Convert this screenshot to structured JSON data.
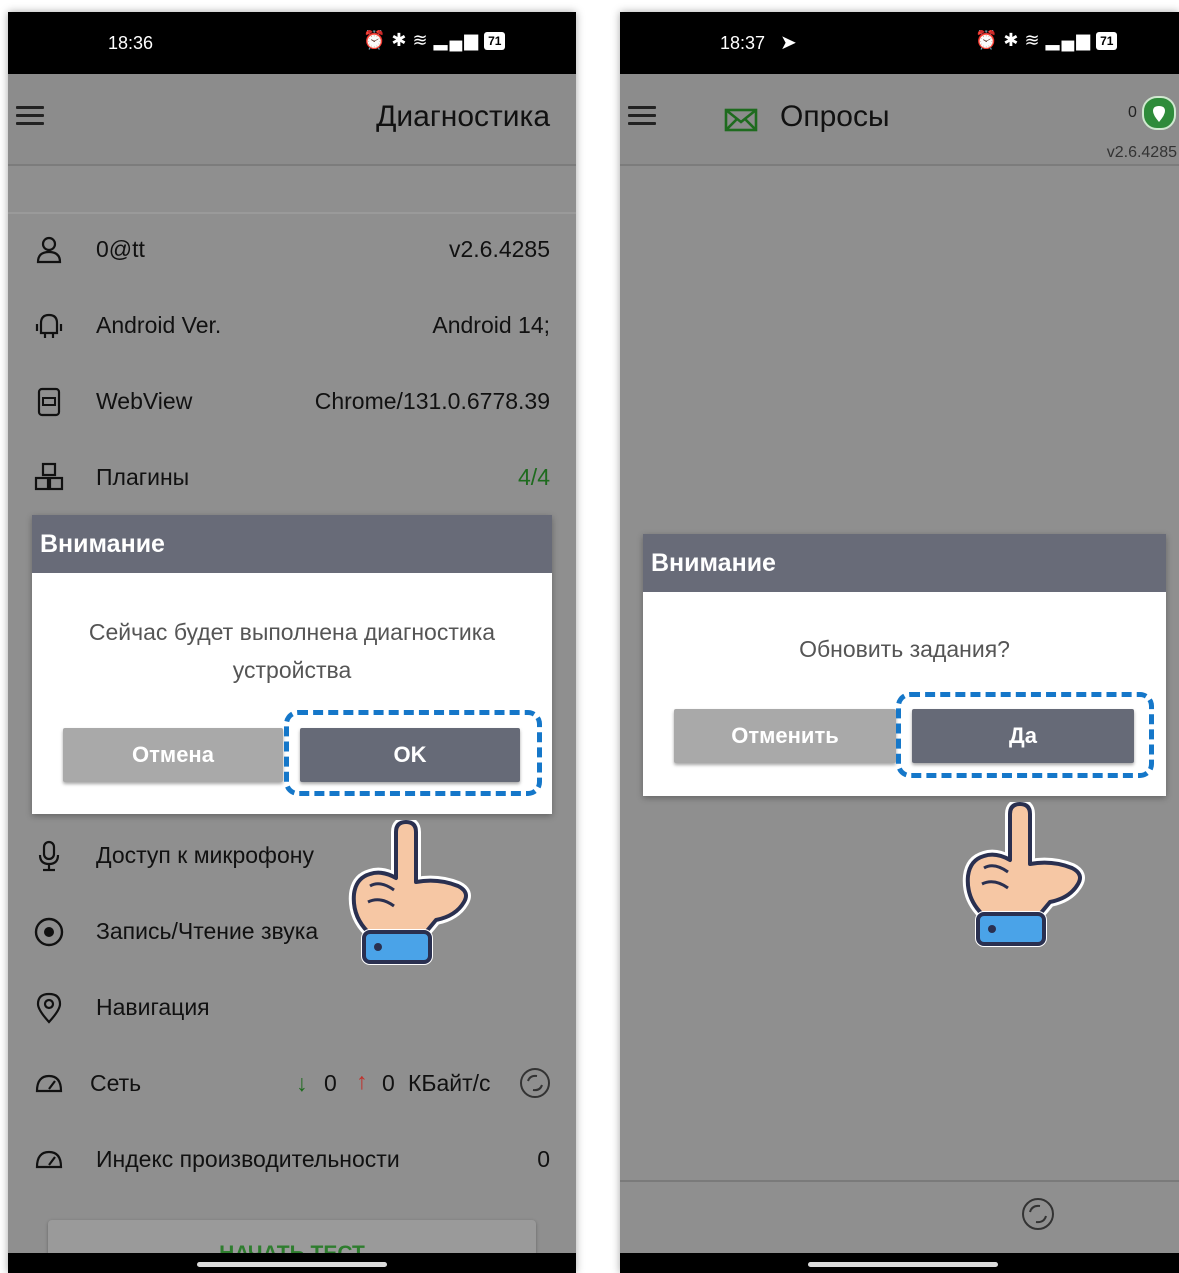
{
  "left": {
    "status_time": "18:36",
    "battery": "71",
    "title": "Диагностика",
    "rows": [
      {
        "label": "0@tt",
        "value": "v2.6.4285"
      },
      {
        "label": "Android Ver.",
        "value": "Android 14;"
      },
      {
        "label": "WebView",
        "value": "Chrome/131.0.6778.39"
      },
      {
        "label": "Плагины",
        "value": "4/4"
      },
      {
        "label": "Доступ к микрофону",
        "value": ""
      },
      {
        "label": "Запись/Чтение звука",
        "value": ""
      },
      {
        "label": "Навигация",
        "value": ""
      },
      {
        "label": "Сеть",
        "value": ""
      },
      {
        "label": "Индекс производительности",
        "value": "0"
      }
    ],
    "network": {
      "down_arrow": "↓",
      "down": "0",
      "up_arrow": "↑",
      "up": "0",
      "unit": "КБайт/с"
    },
    "start_test": "НАЧАТЬ ТЕСТ",
    "dialog": {
      "header": "Внимание",
      "message_line1": "Сейчас будет выполнена диагностика",
      "message_line2": "устройства",
      "cancel": "Отмена",
      "ok": "OK"
    }
  },
  "right": {
    "status_time": "18:37",
    "battery": "71",
    "title": "Опросы",
    "badge_count": "0",
    "version": "v2.6.4285",
    "dialog": {
      "header": "Внимание",
      "message": "Обновить задания?",
      "cancel": "Отменить",
      "ok": "Да"
    }
  },
  "colors": {
    "dialog_header": "#686b78",
    "highlight": "#1577c9",
    "green": "#1e6b1e",
    "red": "#c0302a"
  }
}
